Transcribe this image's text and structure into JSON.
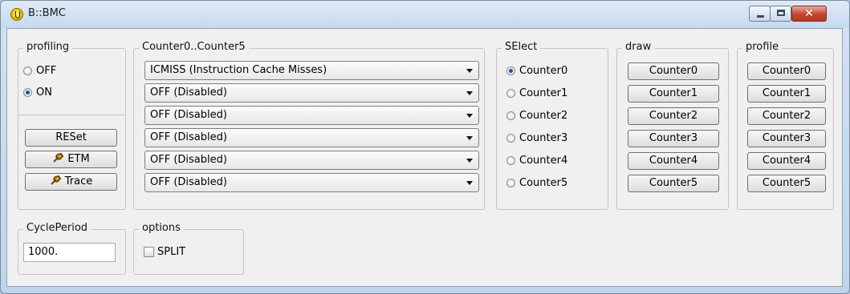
{
  "window": {
    "title": "B::BMC"
  },
  "profiling": {
    "legend": "profiling",
    "options": [
      {
        "label": "OFF",
        "selected": false
      },
      {
        "label": "ON",
        "selected": true
      }
    ],
    "buttons": {
      "reset": "RESet",
      "etm": "ETM",
      "trace": "Trace"
    }
  },
  "counters": {
    "legend": "Counter0..Counter5",
    "selects": [
      "ICMISS (Instruction Cache Misses)",
      "OFF (Disabled)",
      "OFF (Disabled)",
      "OFF (Disabled)",
      "OFF (Disabled)",
      "OFF (Disabled)"
    ]
  },
  "select_group": {
    "legend": "SElect",
    "options": [
      {
        "label": "Counter0",
        "selected": true
      },
      {
        "label": "Counter1",
        "selected": false
      },
      {
        "label": "Counter2",
        "selected": false
      },
      {
        "label": "Counter3",
        "selected": false
      },
      {
        "label": "Counter4",
        "selected": false
      },
      {
        "label": "Counter5",
        "selected": false
      }
    ]
  },
  "draw": {
    "legend": "draw",
    "buttons": [
      "Counter0",
      "Counter1",
      "Counter2",
      "Counter3",
      "Counter4",
      "Counter5"
    ]
  },
  "profile": {
    "legend": "profile",
    "buttons": [
      "Counter0",
      "Counter1",
      "Counter2",
      "Counter3",
      "Counter4",
      "Counter5"
    ]
  },
  "cycle_period": {
    "legend": "CyclePeriod",
    "value": "1000."
  },
  "options": {
    "legend": "options",
    "split_label": "SPLIT",
    "split_checked": false
  }
}
